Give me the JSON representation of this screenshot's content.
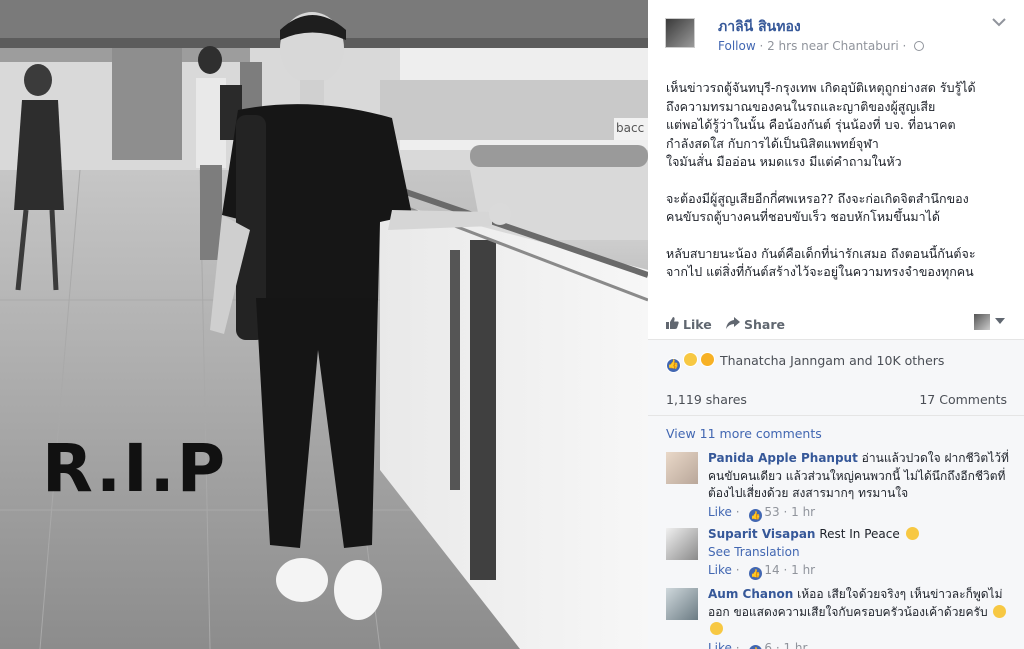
{
  "photo": {
    "overlay_text": "R.I.P",
    "sign_text": "bacc"
  },
  "post": {
    "author": "ภาลินี สินทอง",
    "follow_label": "Follow",
    "meta": "· 2 hrs near Chantaburi ·",
    "paragraphs": [
      [
        "เห็นข่าวรถตู้จันทบุรี-กรุงเทพ เกิดอุบัติเหตุถูกย่างสด รับรู้ได้",
        "ถึงความทรมาณของคนในรถและญาติของผู้สูญเสีย",
        "แต่พอได้รู้ว่าในนั้น คือน้องกันต์ รุ่นน้องที่ บจ. ที่อนาคต",
        "กำลังสดใส กับการได้เป็นนิสิตแพทย์จุฬา",
        "ใจมันสั่น มืออ่อน หมดแรง มีแต่คำถามในหัว"
      ],
      [
        "จะต้องมีผู้สูญเสียอีกกี่ศพเหรอ?? ถึงจะก่อเกิดจิตสำนึกของ",
        "คนขับรถตู้บางคนที่ชอบขับเร็ว ชอบหักโหมขึ้นมาได้"
      ],
      [
        "หลับสบายนะน้อง กันต์คือเด็กที่น่ารักเสมอ ถึงตอนนี้กันต์จะ",
        "จากไป แต่สิ่งที่กันต์สร้างไว้จะอยู่ในความทรงจำของทุกคน"
      ]
    ],
    "like_label": "Like",
    "share_label": "Share"
  },
  "feedback": {
    "reactions_text": "Thanatcha Janngam and 10K others",
    "shares": "1,119 shares",
    "comments_count": "17 Comments",
    "view_more": "View 11 more comments",
    "comments": [
      {
        "name": "Panida Apple Phanput",
        "text": "อ่านแล้วปวดใจ ฝากชีวิตไว้ที่คนขับคนเดียว แล้วส่วนใหญ่คนพวกนี้ ไม่ได้นึกถึงอีกชีวิตที่ต้องไปเสี่ยงด้วย สงสารมากๆ ทรมานใจ",
        "like": "Like",
        "likes": "53",
        "time": "1 hr"
      },
      {
        "name": "Suparit Visapan",
        "text": "Rest In Peace",
        "see_translation": "See Translation",
        "like": "Like",
        "likes": "14",
        "time": "1 hr"
      },
      {
        "name": "Aum Chanon",
        "text": "เห้ออ เสียใจด้วยจริงๆ เห็นข่าวละก็พูดไม่ออก ขอแสดงความเสียใจกับครอบครัวน้องเค้าด้วยครับ",
        "like": "Like",
        "likes": "6",
        "time": "1 hr"
      }
    ]
  },
  "colors": {
    "link": "#365899",
    "action_blue": "#4267b2",
    "muted": "#90949c",
    "feedback_bg": "#f6f7f9"
  },
  "icons": [
    "globe-icon",
    "chevron-down-icon",
    "like-thumb-icon",
    "share-arrow-icon",
    "like-reaction-icon",
    "sad-reaction-icon",
    "wow-reaction-icon"
  ]
}
